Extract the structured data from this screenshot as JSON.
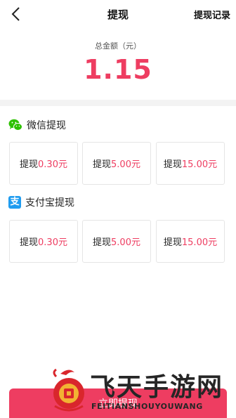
{
  "header": {
    "title": "提现",
    "right_link": "提现记录"
  },
  "balance": {
    "label": "总金额（元）",
    "value": "1.15"
  },
  "wechat": {
    "title": "微信提现",
    "options": [
      {
        "prefix": "提现",
        "amount": "0.30元"
      },
      {
        "prefix": "提现",
        "amount": "5.00元"
      },
      {
        "prefix": "提现",
        "amount": "15.00元"
      }
    ]
  },
  "alipay": {
    "title": "支付宝提现",
    "icon_char": "支",
    "options": [
      {
        "prefix": "提现",
        "amount": "0.30元"
      },
      {
        "prefix": "提现",
        "amount": "5.00元"
      },
      {
        "prefix": "提现",
        "amount": "15.00元"
      }
    ]
  },
  "submit": {
    "label": "立即提现"
  },
  "watermark": {
    "brand_cn": "飞天手游网",
    "brand_en": "FEITIANSHOUYOUWANG"
  },
  "colors": {
    "accent": "#ee3d61",
    "wechat": "#2dc100",
    "alipay": "#1f9cf0"
  },
  "icons": {
    "back": "back-arrow-icon",
    "wechat": "wechat-icon",
    "alipay": "alipay-icon"
  }
}
